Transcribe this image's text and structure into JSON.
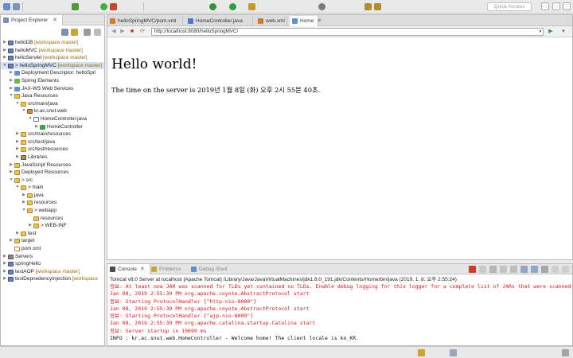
{
  "toolbar": {
    "quick_access_placeholder": "Quick Access",
    "icons": [
      "new-icon",
      "save-icon",
      "debug-icon",
      "run-icon",
      "server-start-icon",
      "search-icon",
      "back-icon",
      "forward-icon"
    ]
  },
  "project_explorer": {
    "tab_label": "Project Explorer",
    "tree": [
      {
        "label": "helloDB",
        "decoration": " [workspace master]",
        "depth": 0,
        "expanded": false,
        "icon": "project"
      },
      {
        "label": "helloMVC",
        "decoration": " [workspace master]",
        "depth": 0,
        "expanded": false,
        "icon": "project"
      },
      {
        "label": "helloServlet",
        "decoration": " [workspace master]",
        "depth": 0,
        "expanded": false,
        "icon": "project"
      },
      {
        "label": "> helloSpringMVC",
        "decoration": " [workspace master]",
        "depth": 0,
        "expanded": true,
        "icon": "project",
        "selected": true
      },
      {
        "label": "Deployment Descriptor: helloSpri",
        "decoration": "",
        "depth": 1,
        "expanded": false,
        "icon": "web"
      },
      {
        "label": "Spring Elements",
        "decoration": "",
        "depth": 1,
        "expanded": false,
        "icon": "spring"
      },
      {
        "label": "JAX-WS Web Services",
        "decoration": "",
        "depth": 1,
        "expanded": false,
        "icon": "web"
      },
      {
        "label": "Java Resources",
        "decoration": "",
        "depth": 1,
        "expanded": true,
        "icon": "folder"
      },
      {
        "label": "src/main/java",
        "decoration": "",
        "depth": 2,
        "expanded": true,
        "icon": "folder"
      },
      {
        "label": "kr.ac.snut.web",
        "decoration": "",
        "depth": 3,
        "expanded": true,
        "icon": "pkg"
      },
      {
        "label": "HomeController.java",
        "decoration": "",
        "depth": 4,
        "expanded": true,
        "icon": "java"
      },
      {
        "label": "HomeController",
        "decoration": "",
        "depth": 5,
        "expanded": false,
        "icon": "class"
      },
      {
        "label": "src/main/resources",
        "decoration": "",
        "depth": 2,
        "expanded": false,
        "icon": "folder"
      },
      {
        "label": "src/test/java",
        "decoration": "",
        "depth": 2,
        "expanded": false,
        "icon": "folder"
      },
      {
        "label": "src/test/resources",
        "decoration": "",
        "depth": 2,
        "expanded": false,
        "icon": "folder"
      },
      {
        "label": "Libraries",
        "decoration": "",
        "depth": 2,
        "expanded": false,
        "icon": "lib"
      },
      {
        "label": "JavaScript Resources",
        "decoration": "",
        "depth": 1,
        "expanded": false,
        "icon": "folder"
      },
      {
        "label": "Deployed Resources",
        "decoration": "",
        "depth": 1,
        "expanded": false,
        "icon": "folder"
      },
      {
        "label": "> src",
        "decoration": "",
        "depth": 1,
        "expanded": true,
        "icon": "folder"
      },
      {
        "label": "> main",
        "decoration": "",
        "depth": 2,
        "expanded": true,
        "icon": "folder"
      },
      {
        "label": "java",
        "decoration": "",
        "depth": 3,
        "expanded": false,
        "icon": "folder"
      },
      {
        "label": "resources",
        "decoration": "",
        "depth": 3,
        "expanded": false,
        "icon": "folder"
      },
      {
        "label": "> webapp",
        "decoration": "",
        "depth": 3,
        "expanded": true,
        "icon": "folder"
      },
      {
        "label": "resources",
        "decoration": "",
        "depth": 4,
        "expanded": false,
        "icon": "folder",
        "leaf": true
      },
      {
        "label": "> WEB-INF",
        "decoration": "",
        "depth": 4,
        "expanded": false,
        "icon": "folder"
      },
      {
        "label": "test",
        "decoration": "",
        "depth": 2,
        "expanded": false,
        "icon": "folder"
      },
      {
        "label": "target",
        "decoration": "",
        "depth": 1,
        "expanded": false,
        "icon": "folder"
      },
      {
        "label": "pom.xml",
        "decoration": "",
        "depth": 1,
        "expanded": false,
        "icon": "xml",
        "leaf": true
      },
      {
        "label": "Servers",
        "decoration": "",
        "depth": 0,
        "expanded": false,
        "icon": "server"
      },
      {
        "label": "springHello",
        "decoration": "",
        "depth": 0,
        "expanded": false,
        "icon": "project"
      },
      {
        "label": "testAOP",
        "decoration": " [workspace master]",
        "depth": 0,
        "expanded": false,
        "icon": "project"
      },
      {
        "label": "testDepnedencyInjection",
        "decoration": " [workspace",
        "depth": 0,
        "expanded": false,
        "icon": "project"
      }
    ]
  },
  "editor": {
    "tabs": [
      {
        "label": "helloSpringMVC/pom.xml",
        "active": false
      },
      {
        "label": "HomeController.java",
        "active": false
      },
      {
        "label": "web.xml",
        "active": false
      },
      {
        "label": "Home",
        "active": true
      }
    ],
    "url": "http://localhost:8080/helloSpringMVC/",
    "page": {
      "heading": "Hello world!",
      "text": "The time on the server is 2019년 1월 8일 (화) 오후 2시 55분 40초."
    }
  },
  "console": {
    "tabs": [
      {
        "label": "Console",
        "active": true
      },
      {
        "label": "Problems",
        "active": false
      },
      {
        "label": "Debug Shell",
        "active": false
      }
    ],
    "description": "Tomcat v8.0 Server at localhost [Apache Tomcat] /Library/Java/JavaVirtualMachines/jdk1.8.0_191.jdk/Contents/Home/bin/java (2019. 1. 8. 오후 2:55:24)",
    "lines": [
      {
        "text": "정보: At least one JAR was scanned for TLDs yet contained no TLDs. Enable debug logging for this logger for a complete list of JARs that were scanned",
        "level": "err"
      },
      {
        "text": "Jan 08, 2019 2:55:39 PM org.apache.coyote.AbstractProtocol start",
        "level": "err"
      },
      {
        "text": "정보: Starting ProtocolHandler [\"http-nio-8080\"]",
        "level": "err"
      },
      {
        "text": "Jan 08, 2019 2:55:39 PM org.apache.coyote.AbstractProtocol start",
        "level": "err"
      },
      {
        "text": "정보: Starting ProtocolHandler [\"ajp-nio-8009\"]",
        "level": "err"
      },
      {
        "text": "Jan 08, 2019 2:55:39 PM org.apache.catalina.startup.Catalina start",
        "level": "err"
      },
      {
        "text": "정보: Server startup in 10699 ms",
        "level": "err"
      },
      {
        "text": "INFO : kr.ac.snut.web.HomeController - Welcome home! The client locale is ko_KR.",
        "level": "info"
      }
    ]
  },
  "colors": {
    "error_text": "#e3141e",
    "decoration_text": "#9a6b00",
    "selection": "#d6e3f5"
  }
}
